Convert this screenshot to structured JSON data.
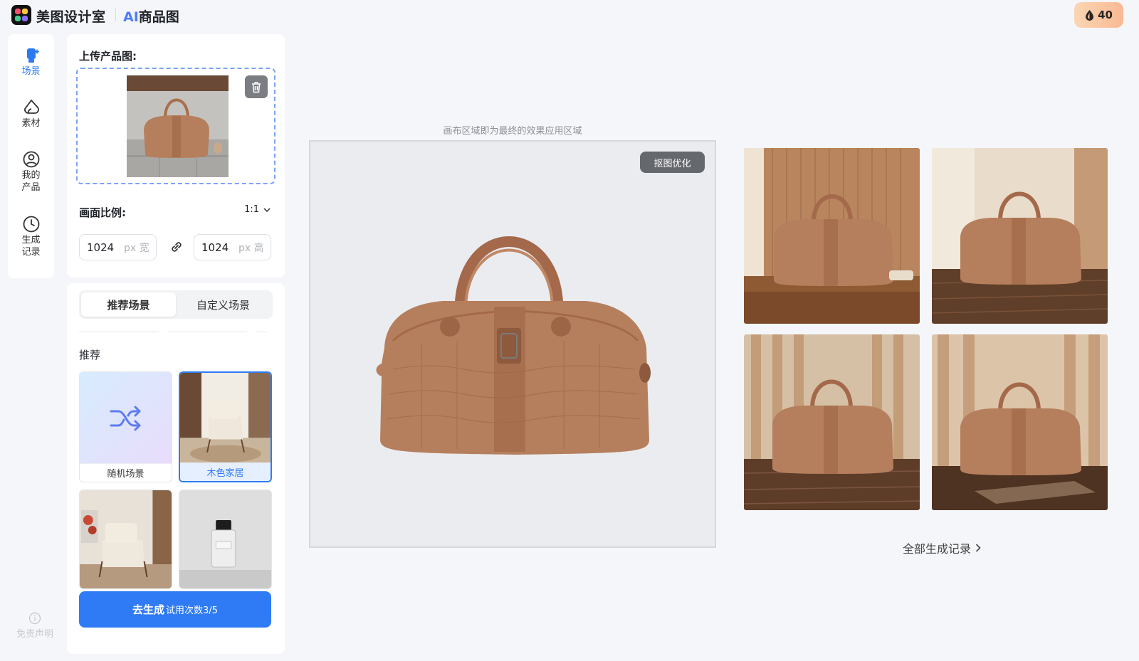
{
  "header": {
    "brand": "美图设计室",
    "product_ai": "AI",
    "product_name": "商品图",
    "credits": "40"
  },
  "nav": {
    "items": [
      {
        "label": "场景",
        "icon": "scene-icon",
        "active": true
      },
      {
        "label": "素材",
        "icon": "material-icon"
      },
      {
        "label": "我的产品",
        "icon": "user-icon"
      },
      {
        "label": "生成记录",
        "icon": "clock-icon"
      }
    ],
    "disclaimer": "免责声明"
  },
  "upload": {
    "title": "上传产品图:"
  },
  "ratio": {
    "title": "画面比例:",
    "value": "1:1",
    "width_value": "1024",
    "width_unit": "px 宽",
    "height_value": "1024",
    "height_unit": "px 高"
  },
  "scenes": {
    "tabs": [
      "推荐场景",
      "自定义场景"
    ],
    "active_tab": 0,
    "section_label": "推荐",
    "cards": [
      {
        "label": "随机场景",
        "icon": "shuffle-icon"
      },
      {
        "label": "木色家居",
        "selected": true
      },
      {
        "label": ""
      },
      {
        "label": ""
      }
    ]
  },
  "generate": {
    "label": "去生成",
    "trial": "试用次数3/5"
  },
  "canvas": {
    "caption": "画布区域即为最终的效果应用区域",
    "matting_button": "抠图优化"
  },
  "results": {
    "all_records": "全部生成记录"
  },
  "colors": {
    "accent": "#2f7bf5",
    "bag": "#b57f5d",
    "credits_bg": "#f9b993"
  }
}
